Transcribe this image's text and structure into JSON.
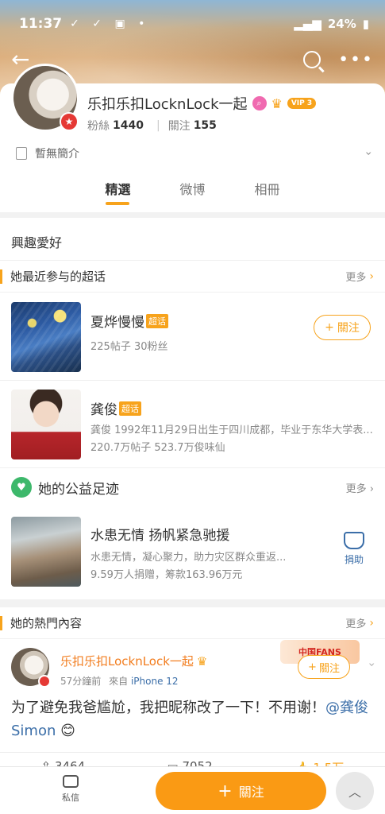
{
  "status_bar": {
    "time": "11:37",
    "icons": "✓ ✓ ▣ •",
    "battery": "24%"
  },
  "profile": {
    "name": "乐扣乐扣LocknLock一起",
    "vip": "VIP 3",
    "fans_label": "粉絲",
    "fans": "1440",
    "following_label": "關注",
    "following": "155",
    "bio": "暫無簡介"
  },
  "tabs": [
    "精選",
    "微博",
    "相冊"
  ],
  "interests_title": "興趣愛好",
  "super_topics": {
    "title": "她最近参与的超话",
    "more": "更多",
    "items": [
      {
        "name": "夏烨慢慢",
        "tag": "超话",
        "line1": "225帖子 30粉丝",
        "follow": "關注"
      },
      {
        "name": "龚俊",
        "tag": "超话",
        "line1": "龚俊 1992年11月29日出生于四川成都，毕业于东华大学表...",
        "line2": "220.7万帖子 523.7万俊味仙"
      }
    ]
  },
  "charity": {
    "title": "她的公益足迹",
    "more": "更多",
    "item": {
      "title": "水患无情 扬帆紧急驰援",
      "line1": "水患无情，凝心聚力，助力灾区群众重返...",
      "line2": "9.59万人捐赠，筹款163.96万元",
      "donate": "捐助"
    }
  },
  "hot": {
    "title": "她的熱門內容",
    "more": "更多",
    "post": {
      "author": "乐扣乐扣LocknLock一起",
      "time": "57分鐘前",
      "from_label": "來自",
      "device": "iPhone 12",
      "follow": "關注",
      "badge": "中国FANS",
      "text": "为了避免我爸尴尬，我把昵称改了一下！不用谢！",
      "mention": "@龚俊Simon",
      "emoji": "😊",
      "reposts": "3464",
      "comments": "7052",
      "likes": "1.5万"
    }
  },
  "bottom": {
    "message": "私信",
    "follow": "關注"
  }
}
